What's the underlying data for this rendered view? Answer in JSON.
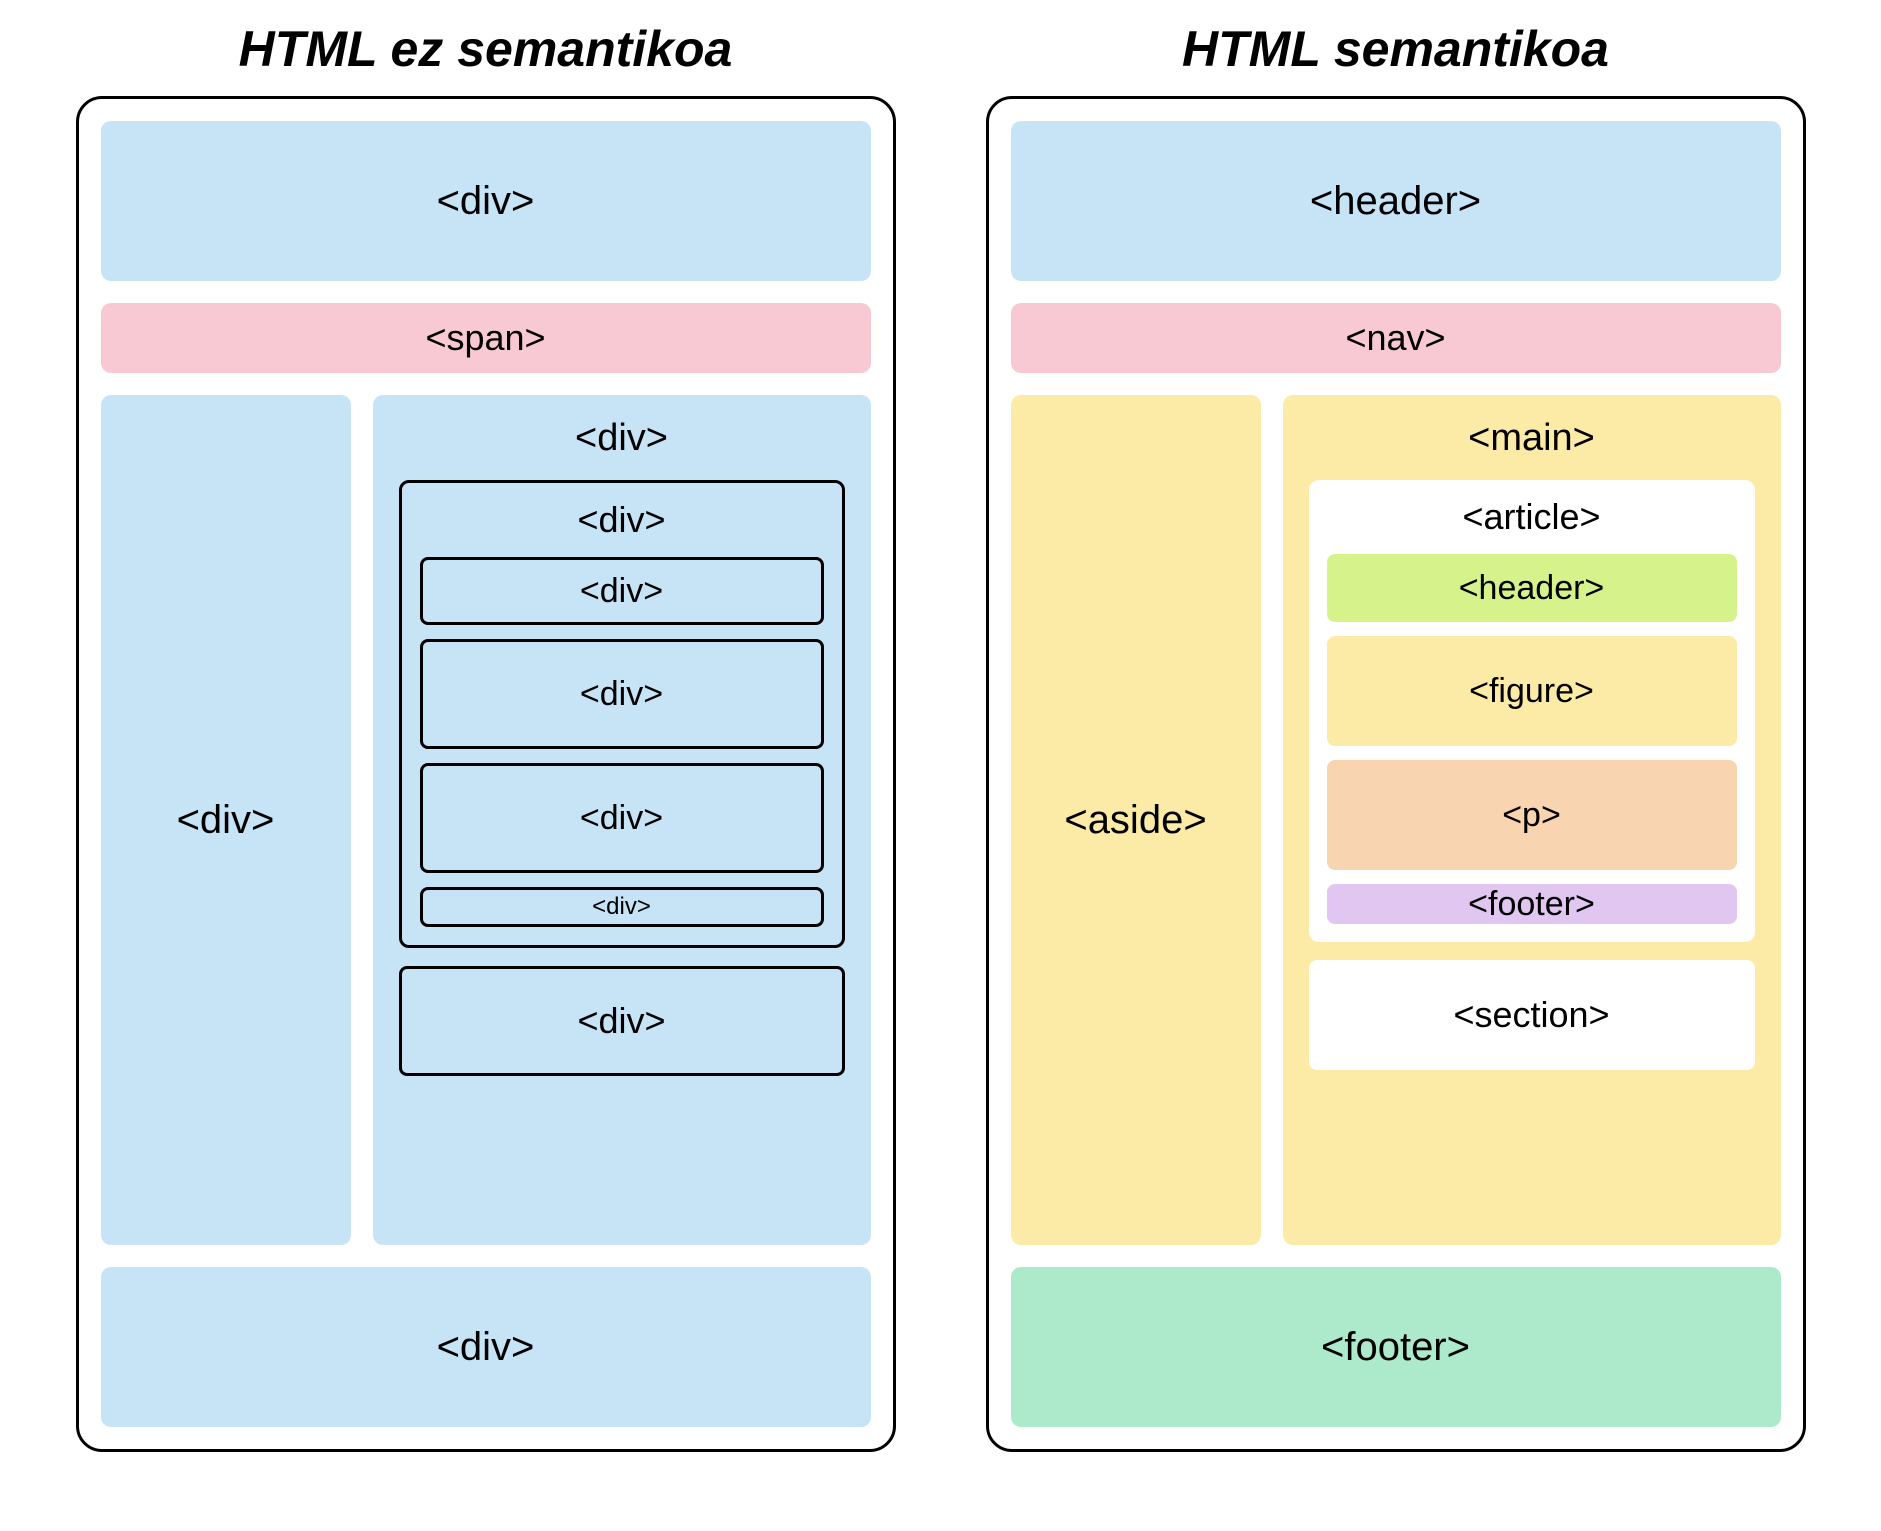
{
  "left": {
    "title": "HTML ez semantikoa",
    "header": "<div>",
    "nav": "<span>",
    "aside": "<div>",
    "main": "<div>",
    "article": "<div>",
    "inner_header": "<div>",
    "inner_figure": "<div>",
    "inner_p": "<div>",
    "inner_footer": "<div>",
    "section": "<div>",
    "footer": "<div>"
  },
  "right": {
    "title": "HTML semantikoa",
    "header": "<header>",
    "nav": "<nav>",
    "aside": "<aside>",
    "main": "<main>",
    "article": "<article>",
    "inner_header": "<header>",
    "inner_figure": "<figure>",
    "inner_p": "<p>",
    "inner_footer": "<footer>",
    "section": "<section>",
    "footer": "<footer>"
  },
  "colors": {
    "blue": "#C6E4F6",
    "pink": "#F9C9D3",
    "yellow": "#FBEBA6",
    "lime": "#D6F28A",
    "peach": "#F9D4B0",
    "purple": "#E0C6F0",
    "green": "#ADE9CB"
  }
}
